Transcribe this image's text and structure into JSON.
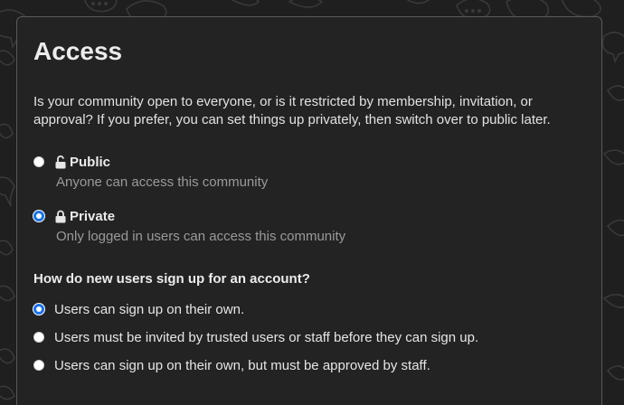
{
  "page": {
    "title": "Access",
    "description": "Is your community open to everyone, or is it restricted by membership, invitation, or approval? If you prefer, you can set things up privately, then switch over to public later."
  },
  "access_options": [
    {
      "label": "Public",
      "sublabel": "Anyone can access this community",
      "icon": "unlocked-padlock-icon",
      "checked": false
    },
    {
      "label": "Private",
      "sublabel": "Only logged in users can access this community",
      "icon": "locked-padlock-icon",
      "checked": true
    }
  ],
  "signup": {
    "question": "How do new users sign up for an account?",
    "options": [
      {
        "label": "Users can sign up on their own.",
        "checked": true
      },
      {
        "label": "Users must be invited by trusted users or staff before they can sign up.",
        "checked": false
      },
      {
        "label": "Users can sign up on their own, but must be approved by staff.",
        "checked": false
      }
    ]
  },
  "colors": {
    "background": "#1f1f1f",
    "card": "#232323",
    "radio_accent": "#1a73e8",
    "muted_text": "#9a9a9a"
  }
}
